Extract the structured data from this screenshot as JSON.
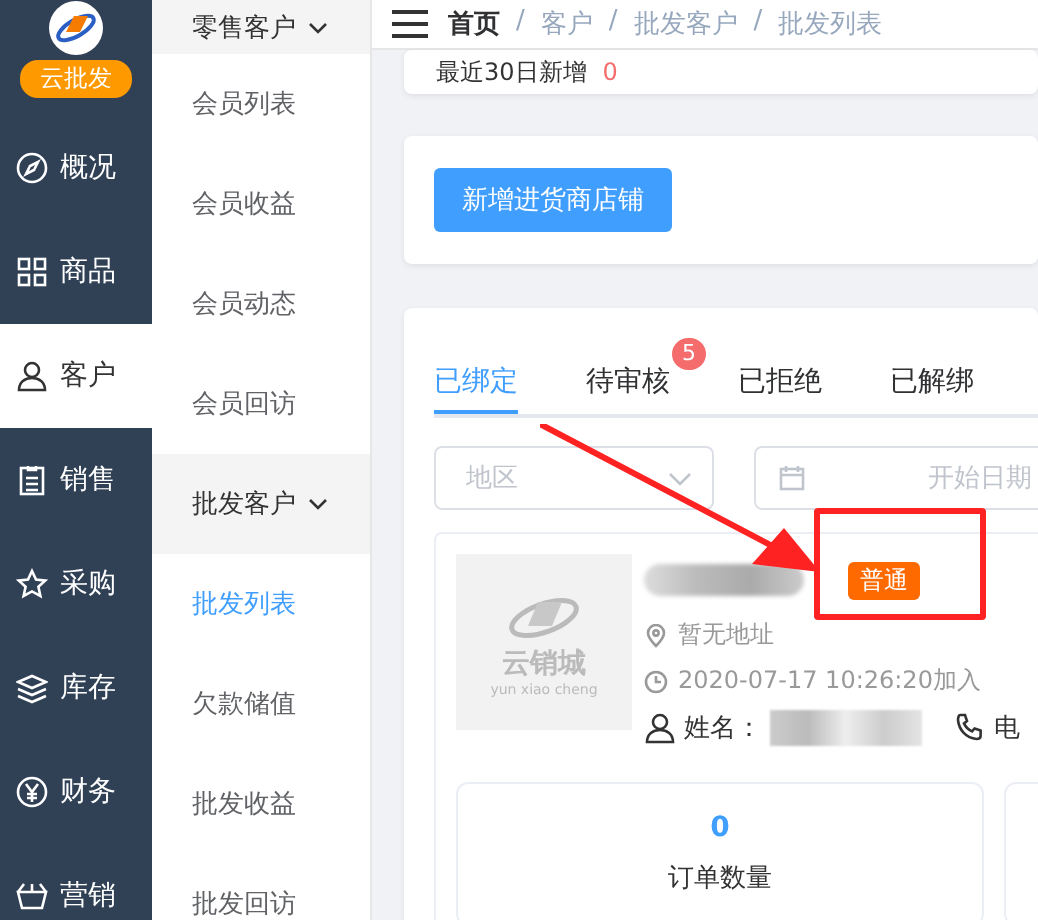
{
  "sidebar": {
    "brand": "云批发",
    "items": [
      {
        "label": "概况",
        "selected": false
      },
      {
        "label": "商品",
        "selected": false
      },
      {
        "label": "客户",
        "selected": true
      },
      {
        "label": "销售",
        "selected": false
      },
      {
        "label": "采购",
        "selected": false
      },
      {
        "label": "库存",
        "selected": false
      },
      {
        "label": "财务",
        "selected": false
      },
      {
        "label": "营销",
        "selected": false
      }
    ]
  },
  "submenu": [
    {
      "label": "零售客户",
      "expanded": true,
      "children": [
        {
          "label": "会员列表",
          "selected": false
        },
        {
          "label": "会员收益",
          "selected": false
        },
        {
          "label": "会员动态",
          "selected": false
        },
        {
          "label": "会员回访",
          "selected": false
        }
      ]
    },
    {
      "label": "批发客户",
      "expanded": true,
      "children": [
        {
          "label": "批发列表",
          "selected": true
        },
        {
          "label": "欠款储值",
          "selected": false
        },
        {
          "label": "批发收益",
          "selected": false
        },
        {
          "label": "批发回访",
          "selected": false
        }
      ]
    }
  ],
  "breadcrumb": {
    "separator": "/",
    "items": [
      "首页",
      "客户",
      "批发客户",
      "批发列表"
    ]
  },
  "summary": {
    "label": "最近30日新增",
    "value": "0"
  },
  "add_button": "新增进货商店铺",
  "tabs": [
    {
      "label": "已绑定",
      "selected": true
    },
    {
      "label": "待审核",
      "selected": false,
      "badge": "5"
    },
    {
      "label": "已拒绝",
      "selected": false
    },
    {
      "label": "已解绑",
      "selected": false
    }
  ],
  "filters": {
    "region": {
      "placeholder": "地区"
    },
    "start_date": {
      "placeholder": "开始日期"
    }
  },
  "customer": {
    "logo_text": "云销城",
    "logo_subtext": "yun xiao cheng",
    "tag": "普通",
    "address": "暂无地址",
    "joined": "2020-07-17 10:26:20加入",
    "name_label": "姓名：",
    "phone_label": "电",
    "stats": [
      {
        "value": "0",
        "label": "订单数量"
      }
    ]
  }
}
